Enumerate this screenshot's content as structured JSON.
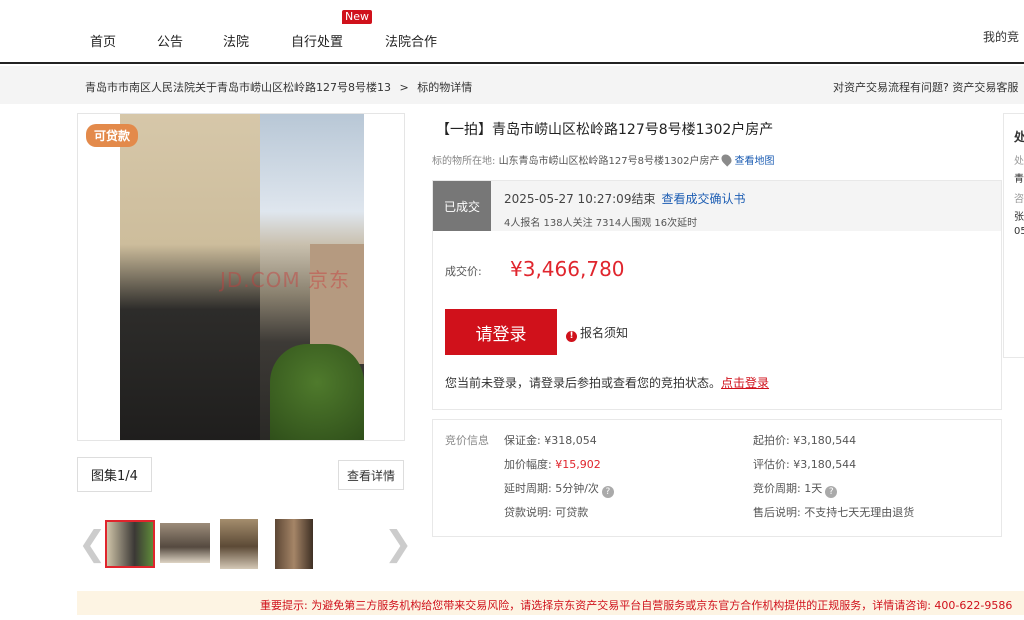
{
  "nav": {
    "items": [
      "首页",
      "公告",
      "法院",
      "自行处置",
      "法院合作"
    ],
    "new_badge": "New",
    "my": "我的竞"
  },
  "breadcrumb": {
    "path": "青岛市市南区人民法院关于青岛市崂山区松岭路127号8号楼13",
    "sep": ">",
    "current": "标的物详情",
    "help": "对资产交易流程有问题? 资产交易客服"
  },
  "gallery": {
    "loan_tag": "可贷款",
    "watermark": "JD.COM 京东",
    "album": "图集1/4",
    "detail_button": "查看详情",
    "prev_icon": "chevron-left-icon",
    "next_icon": "chevron-right-icon"
  },
  "item": {
    "title": "【一拍】青岛市崂山区松岭路127号8号楼1302户房产",
    "location_label": "标的物所在地:",
    "location": "山东青岛市崂山区松岭路127号8号楼1302户房产",
    "map_link": "查看地图"
  },
  "status": {
    "badge": "已成交",
    "end_time": "2025-05-27 10:27:09结束",
    "confirm_link": "查看成交确认书",
    "stats": "4人报名  138人关注  7314人围观  16次延时",
    "price_label": "成交价:",
    "price": "¥3,466,780",
    "login_button": "请登录",
    "notice": "报名须知",
    "login_tip": "您当前未登录，请登录后参拍或查看您的竞拍状态。",
    "login_link": "点击登录"
  },
  "bid_info": {
    "label": "竞价信息",
    "deposit": "保证金: ¥318,054",
    "increment_label": "加价幅度:",
    "increment": "¥15,902",
    "delay": "延时周期: 5分钟/次",
    "loan": "贷款说明: 可贷款",
    "start_price": "起拍价: ¥3,180,544",
    "appraisal": "评估价: ¥3,180,544",
    "cycle": "竞价周期: 1天",
    "after_sale": "售后说明: 不支持七天无理由退货"
  },
  "side": {
    "lines": [
      "处",
      "处",
      "青",
      "咨",
      "张",
      "05"
    ]
  },
  "footer": {
    "tip": "重要提示: 为避免第三方服务机构给您带来交易风险，请选择京东资产交易平台自营服务或京东官方合作机构提供的正规服务，详情请咨询: 400-622-9586"
  },
  "colors": {
    "brand_red": "#d0111b",
    "price_red": "#e0252d",
    "link_blue": "#1c5db3",
    "loan_orange": "#e38a4b"
  }
}
